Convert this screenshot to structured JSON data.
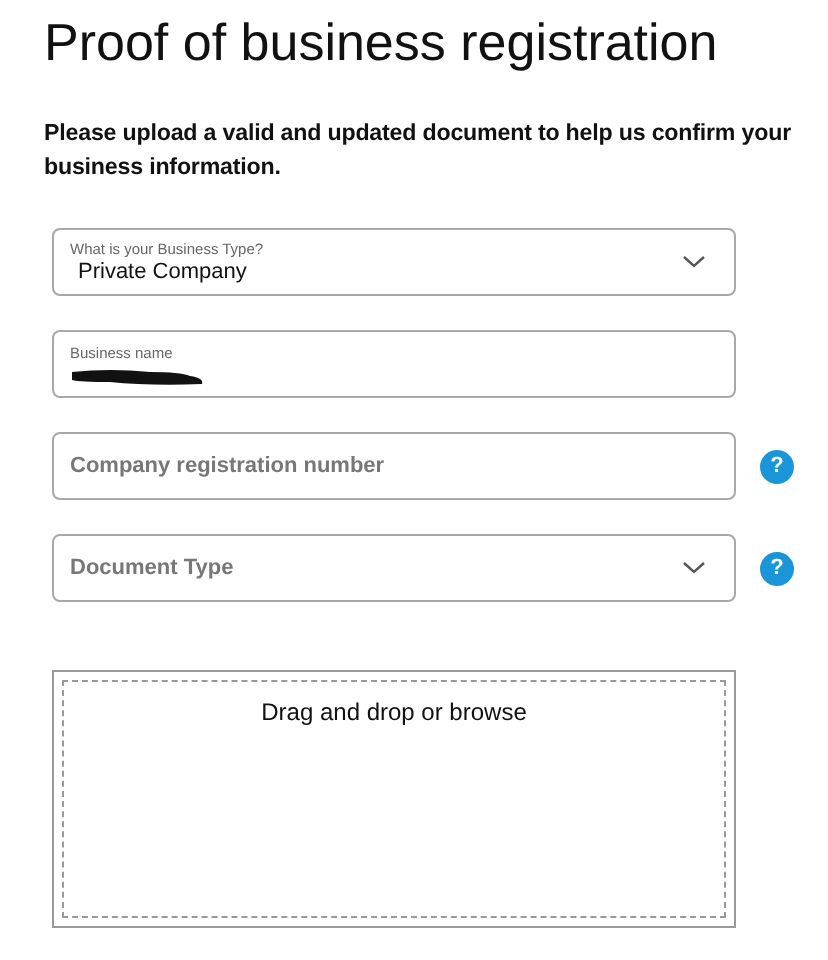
{
  "title": "Proof of business registration",
  "description": "Please upload a valid and updated document to help us confirm your business information.",
  "fields": [
    {
      "kind": "select",
      "label": "What is your Business Type?",
      "value": "Private Company"
    },
    {
      "kind": "text",
      "label": "Business name",
      "redacted": true
    },
    {
      "kind": "text",
      "placeholder": "Company registration number",
      "help": "?"
    },
    {
      "kind": "select",
      "placeholder": "Document Type",
      "help": "?"
    }
  ],
  "dropzone": {
    "text": "Drag and drop or browse"
  }
}
